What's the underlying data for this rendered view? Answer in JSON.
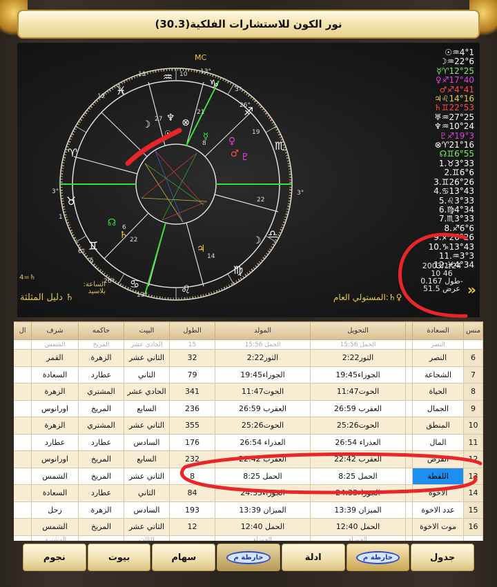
{
  "title": "نور الكون للاستشارات الفلكية(30.3)",
  "planets": [
    {
      "text": "☉♒4°1",
      "color": "#ffffff"
    },
    {
      "text": "☽♒22°6",
      "color": "#ffffff"
    },
    {
      "text": "☿♈12°25",
      "color": "#7cf06a"
    },
    {
      "text": "♀♐17°40",
      "color": "#e040e0"
    },
    {
      "text": "♂♐4°41",
      "color": "#ff4a4a"
    },
    {
      "text": "♃♌14°16",
      "color": "#f0d040"
    },
    {
      "text": "♄♊22°53",
      "color": "#ff4a4a"
    },
    {
      "text": "♅♒27°25",
      "color": "#ffffff"
    },
    {
      "text": "♆♒10°24",
      "color": "#ffffff"
    },
    {
      "text": "♇♐19°3",
      "color": "#e040e0"
    },
    {
      "text": "⊗♈21°16",
      "color": "#ffffff"
    },
    {
      "text": "☊♊6°55",
      "color": "#7cf06a"
    },
    {
      "text": "1.♉3°33",
      "color": "#ffffff"
    },
    {
      "text": "2.♊6°6",
      "color": "#ffffff"
    },
    {
      "text": "3.♊26°26",
      "color": "#ffffff"
    },
    {
      "text": "4.♋13°43",
      "color": "#ffffff"
    },
    {
      "text": "5.♌3°33",
      "color": "#ffffff"
    },
    {
      "text": "6.♍4°34",
      "color": "#ffffff"
    },
    {
      "text": "7.♏3°33",
      "color": "#ffffff"
    },
    {
      "text": "8.♐6°6",
      "color": "#ffffff"
    },
    {
      "text": "9.♐26°26",
      "color": "#ffffff"
    },
    {
      "text": "10.♑13°43",
      "color": "#ffffff"
    },
    {
      "text": "11.♒3°3",
      "color": "#ffffff"
    },
    {
      "text": "12.♓4°34",
      "color": "#ffffff"
    }
  ],
  "date_info": {
    "date": "2003/1/24",
    "time": "10 46",
    "longitude": "طول 0.167-",
    "latitude": "عرض 51.5"
  },
  "guide": {
    "lord_value": "4=♄",
    "hour_label": "الساعة:",
    "city": "بلاسيد",
    "triplicity_link": "♄ دليل المثلثة"
  },
  "ruler_label": "♀♄:المستولي العام",
  "wheel_labels": {
    "mc": "MC",
    "cusps": [
      "11",
      "10",
      "13°",
      "12",
      "3°",
      "4",
      "1",
      "6°",
      "5",
      "26°",
      "13°",
      "3°",
      "26°",
      "3°"
    ],
    "planet_marks": [
      "27",
      "21",
      "19",
      "8",
      "22",
      "6",
      "22",
      "14"
    ]
  },
  "table": {
    "headers": [
      "منس",
      "السعادة",
      "",
      "التحويل",
      "المولد",
      "الطول",
      "البيت",
      "حاكمه",
      "شرف",
      "ال"
    ],
    "faded_top": [
      "",
      "النصر",
      "",
      "الحمل 15:56",
      "الحمل 15:56",
      "15",
      "الحادي عشر",
      "المريخ",
      "الشمس",
      ""
    ],
    "rows": [
      {
        "n": "6",
        "name": "النصر",
        "tahwil": "الثور2:22",
        "mawlid": "الثور2:22",
        "tul": "32",
        "bayt": "الثاني عشر",
        "hakim": "الزهرة",
        "sharaf": "القمر"
      },
      {
        "n": "7",
        "name": "الشجاعة",
        "tahwil": "الجوزاء19:45",
        "mawlid": "الجوزاء19:45",
        "tul": "79",
        "bayt": "الثاني",
        "hakim": "عطارد",
        "sharaf": "السعادة"
      },
      {
        "n": "8",
        "name": "الحياة",
        "tahwil": "الحوت11:47",
        "mawlid": "الحوت11:47",
        "tul": "341",
        "bayt": "الحادي عشر",
        "hakim": "المشتري",
        "sharaf": "الزهرة"
      },
      {
        "n": "9",
        "name": "الجمال",
        "tahwil": "العقرب 26:59",
        "mawlid": "العقرب 26:59",
        "tul": "236",
        "bayt": "السابع",
        "hakim": "المريخ",
        "sharaf": "اورانوس"
      },
      {
        "n": "10",
        "name": "المنطق",
        "tahwil": "الحوت25:26",
        "mawlid": "الحوت25:26",
        "tul": "355",
        "bayt": "الثاني عشر",
        "hakim": "المشتري",
        "sharaf": "الزهرة"
      },
      {
        "n": "11",
        "name": "المال",
        "tahwil": "العذراء 26:54",
        "mawlid": "العذراء 26:54",
        "tul": "176",
        "bayt": "السادس",
        "hakim": "عطارد",
        "sharaf": "عطارد"
      },
      {
        "n": "12",
        "name": "القرض",
        "tahwil": "العقرب 22:42",
        "mawlid": "العقرب 22:42",
        "tul": "232",
        "bayt": "السابع",
        "hakim": "المريخ",
        "sharaf": "اورانوس"
      },
      {
        "n": "13",
        "name": "اللقطة",
        "tahwil": "الحمل 8:25",
        "mawlid": "الحمل 8:25",
        "tul": "8",
        "bayt": "الثاني عشر",
        "hakim": "المريخ",
        "sharaf": "الشمس",
        "selected": true
      },
      {
        "n": "14",
        "name": "الاخوة",
        "tahwil": "الجوزاء24:33",
        "mawlid": "الجوزاء24:33",
        "tul": "84",
        "bayt": "الثاني",
        "hakim": "عطارد",
        "sharaf": "السعادة"
      },
      {
        "n": "15",
        "name": "عدد الاخوة",
        "tahwil": "الميزان 13:39",
        "mawlid": "الميزان 13:39",
        "tul": "193",
        "bayt": "السادس",
        "hakim": "الزهرة",
        "sharaf": "زحل"
      },
      {
        "n": "16",
        "name": "موت الاخوة",
        "tahwil": "الحمل 12:40",
        "mawlid": "الحمل 12:40",
        "tul": "12",
        "bayt": "الثاني عشر",
        "hakim": "المريخ",
        "sharaf": "الشمس"
      }
    ],
    "faded_bottom": [
      "",
      "",
      "",
      "الجوزاء",
      "الجوزاء",
      "",
      "الثالث",
      "",
      "المشتري",
      ""
    ]
  },
  "tabs": [
    {
      "label": "جدول",
      "type": "text"
    },
    {
      "label": "خارطة م",
      "type": "logo",
      "active": true
    },
    {
      "label": "ادلة",
      "type": "text"
    },
    {
      "label": "خارطة م",
      "type": "logo"
    },
    {
      "label": "سهام",
      "type": "text"
    },
    {
      "label": "بيوت",
      "type": "text"
    },
    {
      "label": "نجوم",
      "type": "text"
    }
  ],
  "colors": {
    "accent_gold": "#d8b450",
    "annotation_red": "#e8262a",
    "selected_cell": "#1e8ff0"
  }
}
